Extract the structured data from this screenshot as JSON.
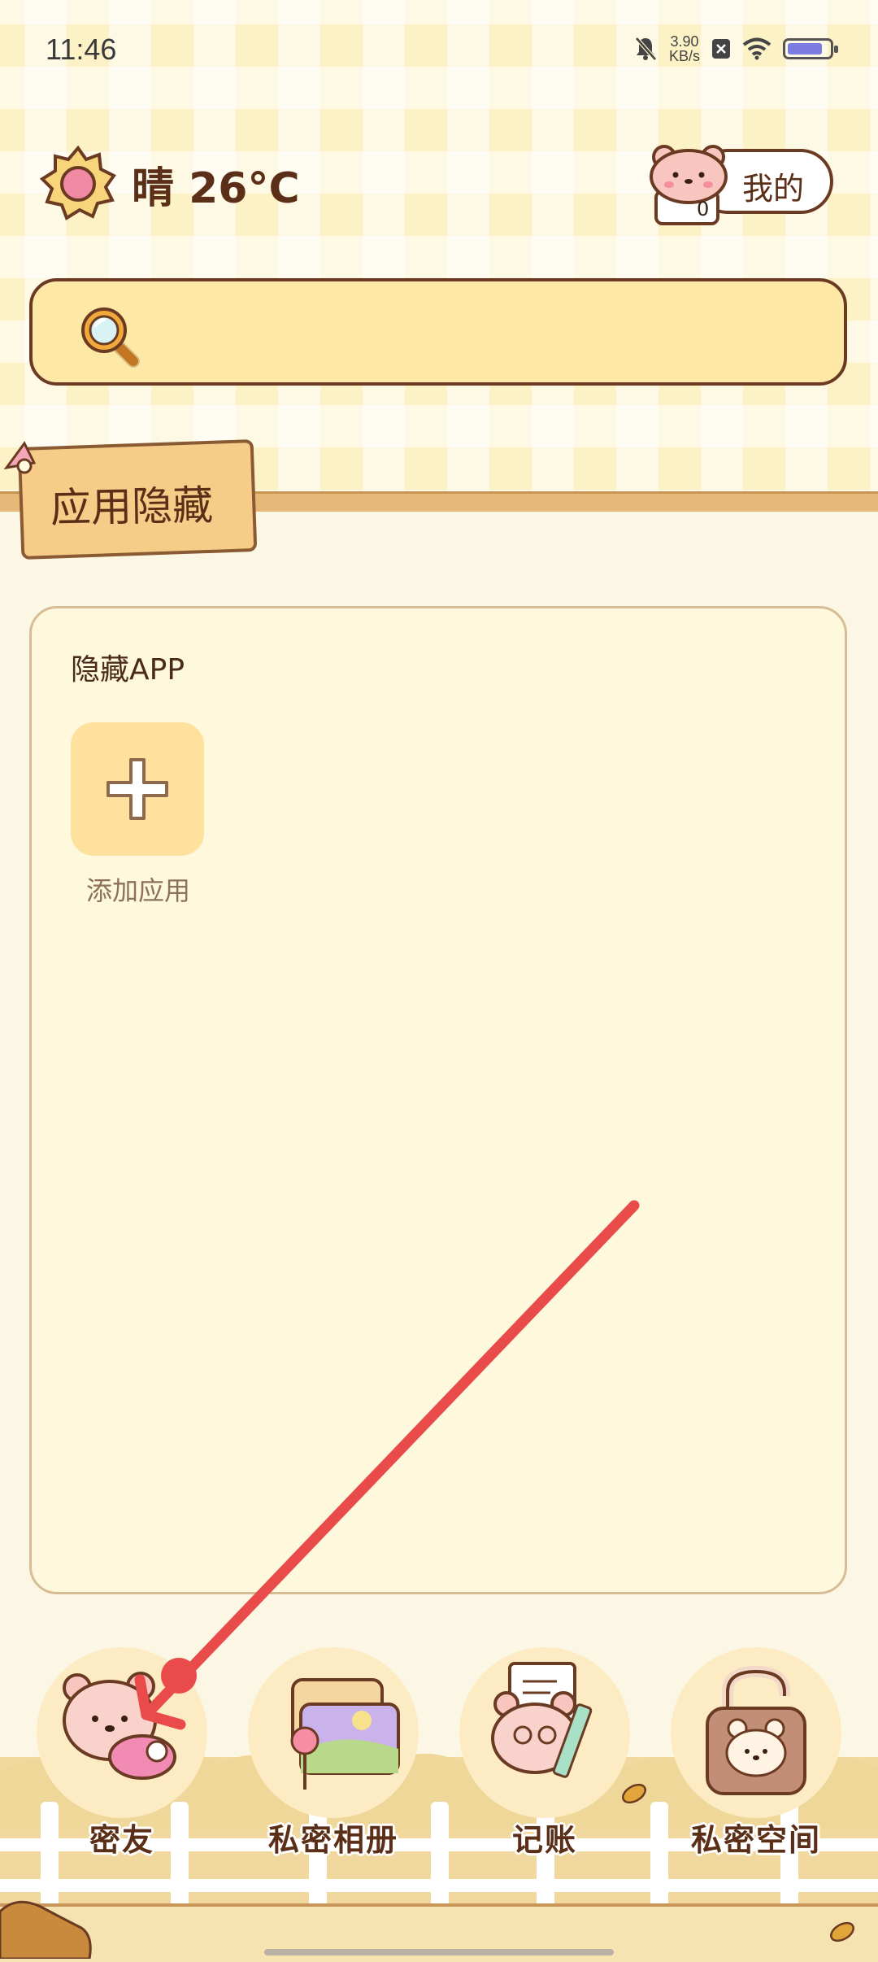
{
  "status_bar": {
    "time": "11:46",
    "net_speed_value": "3.90",
    "net_speed_unit": "KB/s",
    "icons": [
      "mute-bell-icon",
      "close-box-icon",
      "wifi-icon",
      "battery-icon"
    ]
  },
  "weather": {
    "text": "晴 26°C",
    "icon": "sun-icon"
  },
  "profile": {
    "label": "我的",
    "icon": "bear-mascot-icon",
    "badge_value": "0"
  },
  "search": {
    "placeholder": "",
    "icon": "search-icon"
  },
  "section": {
    "title": "应用隐藏"
  },
  "panel": {
    "title": "隐藏APP",
    "add_label": "添加应用"
  },
  "dock": {
    "items": [
      {
        "label": "密友",
        "icon": "bear-friend-icon"
      },
      {
        "label": "私密相册",
        "icon": "photo-album-icon"
      },
      {
        "label": "记账",
        "icon": "accounting-bear-icon"
      },
      {
        "label": "私密空间",
        "icon": "lock-bear-icon"
      }
    ]
  },
  "colors": {
    "accent_brown": "#5b2f17",
    "search_fill": "#fde8a6",
    "panel_fill": "#fef8dc",
    "annotation_arrow": "#e94b4b"
  }
}
